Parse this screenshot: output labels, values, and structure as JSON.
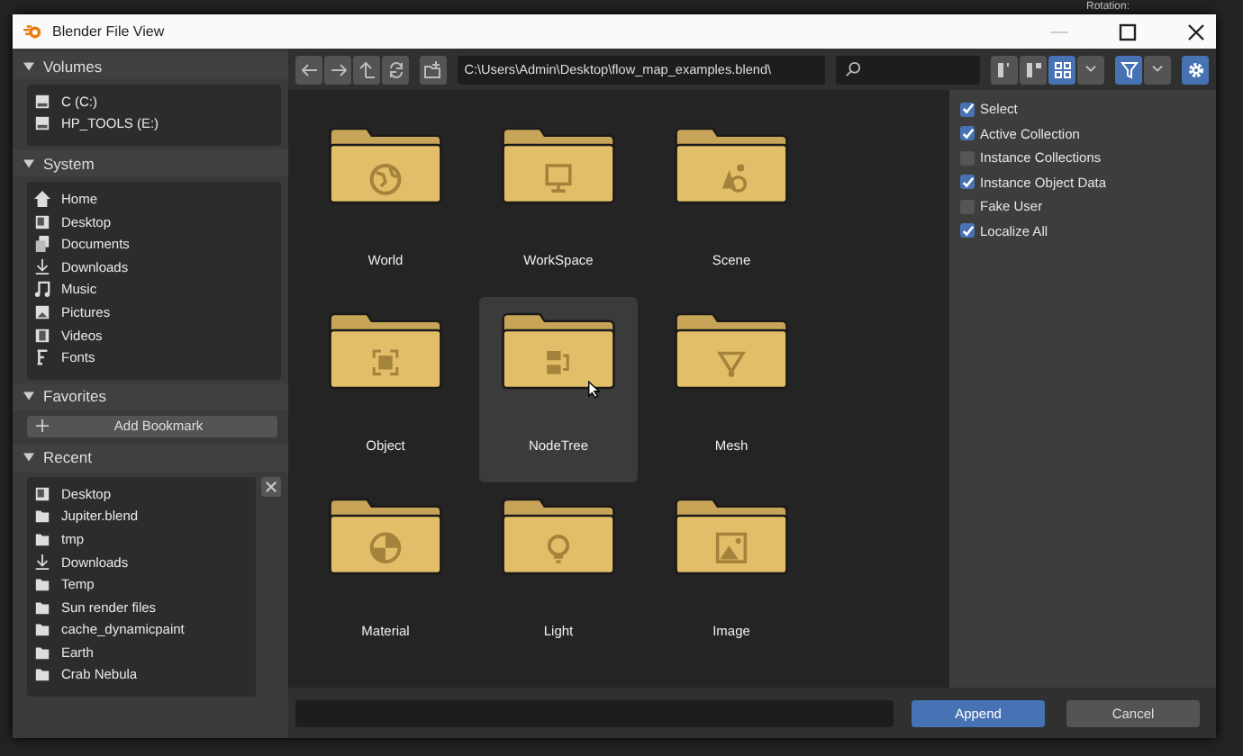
{
  "window": {
    "title": "Blender File View"
  },
  "background": {
    "label": "Rotation:"
  },
  "sidebar": {
    "panels": [
      {
        "title": "Volumes",
        "expanded": true,
        "items": [
          {
            "label": "C (C:)",
            "kind": "drive"
          },
          {
            "label": "HP_TOOLS (E:)",
            "kind": "drive"
          }
        ]
      },
      {
        "title": "System",
        "expanded": true,
        "items": [
          {
            "label": "Home",
            "kind": "home"
          },
          {
            "label": "Desktop",
            "kind": "desktop"
          },
          {
            "label": "Documents",
            "kind": "documents"
          },
          {
            "label": "Downloads",
            "kind": "download"
          },
          {
            "label": "Music",
            "kind": "music"
          },
          {
            "label": "Pictures",
            "kind": "pictures"
          },
          {
            "label": "Videos",
            "kind": "videos"
          },
          {
            "label": "Fonts",
            "kind": "fonts"
          }
        ]
      },
      {
        "title": "Favorites",
        "expanded": true,
        "button": "Add Bookmark"
      },
      {
        "title": "Recent",
        "expanded": true,
        "items": [
          {
            "label": "Desktop",
            "kind": "desktop"
          },
          {
            "label": "Jupiter.blend",
            "kind": "folder"
          },
          {
            "label": "tmp",
            "kind": "folder"
          },
          {
            "label": "Downloads",
            "kind": "download"
          },
          {
            "label": "Temp",
            "kind": "folder"
          },
          {
            "label": "Sun render files",
            "kind": "folder"
          },
          {
            "label": "cache_dynamicpaint",
            "kind": "folder"
          },
          {
            "label": "Earth",
            "kind": "folder"
          },
          {
            "label": "Crab Nebula",
            "kind": "folder"
          }
        ]
      }
    ]
  },
  "toolbar": {
    "path": "C:\\Users\\Admin\\Desktop\\flow_map_examples.blend\\",
    "display_modes": [
      {
        "kind": "vertical-list",
        "selected": false
      },
      {
        "kind": "horizontal-list",
        "selected": false
      },
      {
        "kind": "thumbnails",
        "selected": true
      }
    ],
    "filter": {
      "on": true
    }
  },
  "files": [
    {
      "name": "World",
      "kind": "world",
      "hovered": false
    },
    {
      "name": "WorkSpace",
      "kind": "workspace",
      "hovered": false
    },
    {
      "name": "Scene",
      "kind": "scene",
      "hovered": false
    },
    {
      "name": "Object",
      "kind": "object",
      "hovered": false
    },
    {
      "name": "NodeTree",
      "kind": "nodetree",
      "hovered": true
    },
    {
      "name": "Mesh",
      "kind": "mesh",
      "hovered": false
    },
    {
      "name": "Material",
      "kind": "material",
      "hovered": false
    },
    {
      "name": "Light",
      "kind": "light",
      "hovered": false
    },
    {
      "name": "Image",
      "kind": "image",
      "hovered": false
    }
  ],
  "options": [
    {
      "label": "Select",
      "checked": true
    },
    {
      "label": "Active Collection",
      "checked": true
    },
    {
      "label": "Instance Collections",
      "checked": false
    },
    {
      "label": "Instance Object Data",
      "checked": true
    },
    {
      "label": "Fake User",
      "checked": false
    },
    {
      "label": "Localize All",
      "checked": true
    }
  ],
  "footer": {
    "buttons": [
      {
        "label": "Append",
        "kind": "primary"
      },
      {
        "label": "Cancel",
        "kind": "secondary"
      }
    ]
  }
}
